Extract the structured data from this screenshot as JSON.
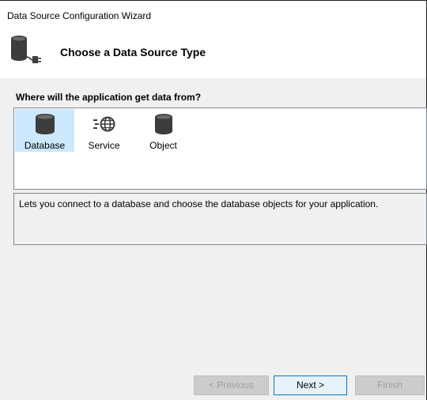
{
  "window": {
    "title": "Data Source Configuration Wizard"
  },
  "header": {
    "title": "Choose a Data Source Type",
    "icon": "database-plug-icon"
  },
  "question": "Where will the application get data from?",
  "sources": [
    {
      "label": "Database",
      "icon": "database-icon",
      "selected": true
    },
    {
      "label": "Service",
      "icon": "service-globe-icon",
      "selected": false
    },
    {
      "label": "Object",
      "icon": "object-cylinder-icon",
      "selected": false
    }
  ],
  "description": "Lets you connect to a database and choose the database objects for your application.",
  "buttons": {
    "previous": "< Previous",
    "next": "Next >",
    "finish": "Finish"
  },
  "colors": {
    "selection": "#cce8ff",
    "accent": "#0078d7",
    "icon": "#3c3c3c"
  }
}
